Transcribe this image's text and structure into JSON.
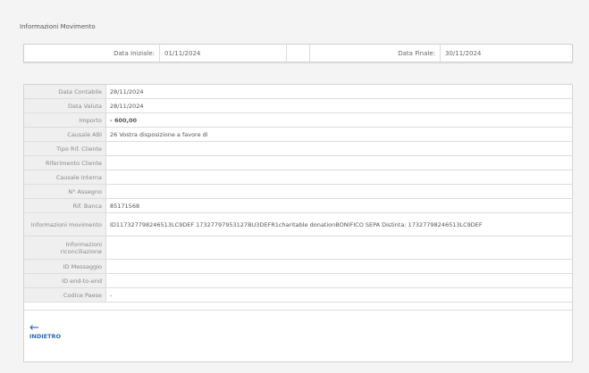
{
  "title": "Informazioni Movimento",
  "dates": {
    "start_label": "Data Iniziale:",
    "start_value": "01/11/2024",
    "end_label": "Data Finale:",
    "end_value": "30/11/2024"
  },
  "rows": [
    {
      "label": "Data Contabile",
      "value": "28/11/2024"
    },
    {
      "label": "Data Valuta",
      "value": "28/11/2024"
    },
    {
      "label": "Importo",
      "value": "- 600,00"
    },
    {
      "label": "Causale ABI",
      "value": "26 Vostra disposizione a favore di"
    },
    {
      "label": "Tipo Rif. Cliente",
      "value": ""
    },
    {
      "label": "Riferimento Cliente",
      "value": ""
    },
    {
      "label": "Causale Interna",
      "value": ""
    },
    {
      "label": "N° Assegno",
      "value": ""
    },
    {
      "label": "Rif. Banca",
      "value": "85171568"
    },
    {
      "label": "Informazioni movimento",
      "value": "ID11732779824651​3LC9DEF 17327797953127BU3DEFR1charitable donationBONIFICO SEPA Distinta: 17327798246513LC9DEF"
    },
    {
      "label": "Informazioni riconciliazione",
      "value": ""
    },
    {
      "label": "ID Messaggio",
      "value": ""
    },
    {
      "label": "ID end-to-end",
      "value": ""
    },
    {
      "label": "Codice Paese",
      "value": "-"
    }
  ],
  "back_label": "INDIETRO",
  "back_icon": "arrow-left-icon",
  "amount_color": "#d0202a"
}
